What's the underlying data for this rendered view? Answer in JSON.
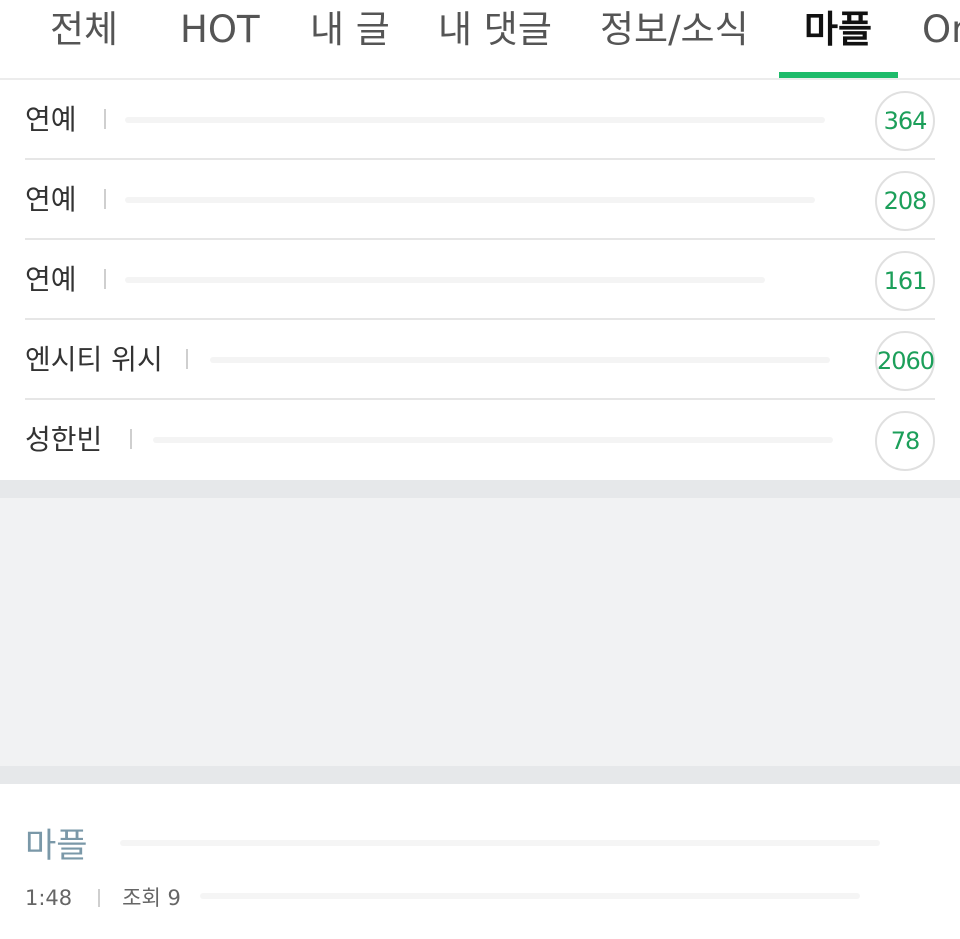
{
  "tabs": [
    {
      "label": "전체",
      "active": false
    },
    {
      "label": "HOT",
      "active": false
    },
    {
      "label": "내 글",
      "active": false
    },
    {
      "label": "내 댓글",
      "active": false
    },
    {
      "label": "정보/소식",
      "active": false
    },
    {
      "label": "마플",
      "active": true
    },
    {
      "label": "On",
      "active": false
    }
  ],
  "list": [
    {
      "label": "연예",
      "count": "364"
    },
    {
      "label": "연예",
      "count": "208"
    },
    {
      "label": "연예",
      "count": "161"
    },
    {
      "label": "엔시티 위시",
      "count": "2060"
    },
    {
      "label": "성한빈",
      "count": "78"
    }
  ],
  "post": {
    "title": "마플",
    "time": "1:48",
    "views": "조회 9"
  },
  "colors": {
    "accent": "#1ebb6a",
    "count_text": "#1c9f5a",
    "post_title": "#7a98a8",
    "band": "#e6e8ea",
    "panel": "#f1f2f3"
  }
}
